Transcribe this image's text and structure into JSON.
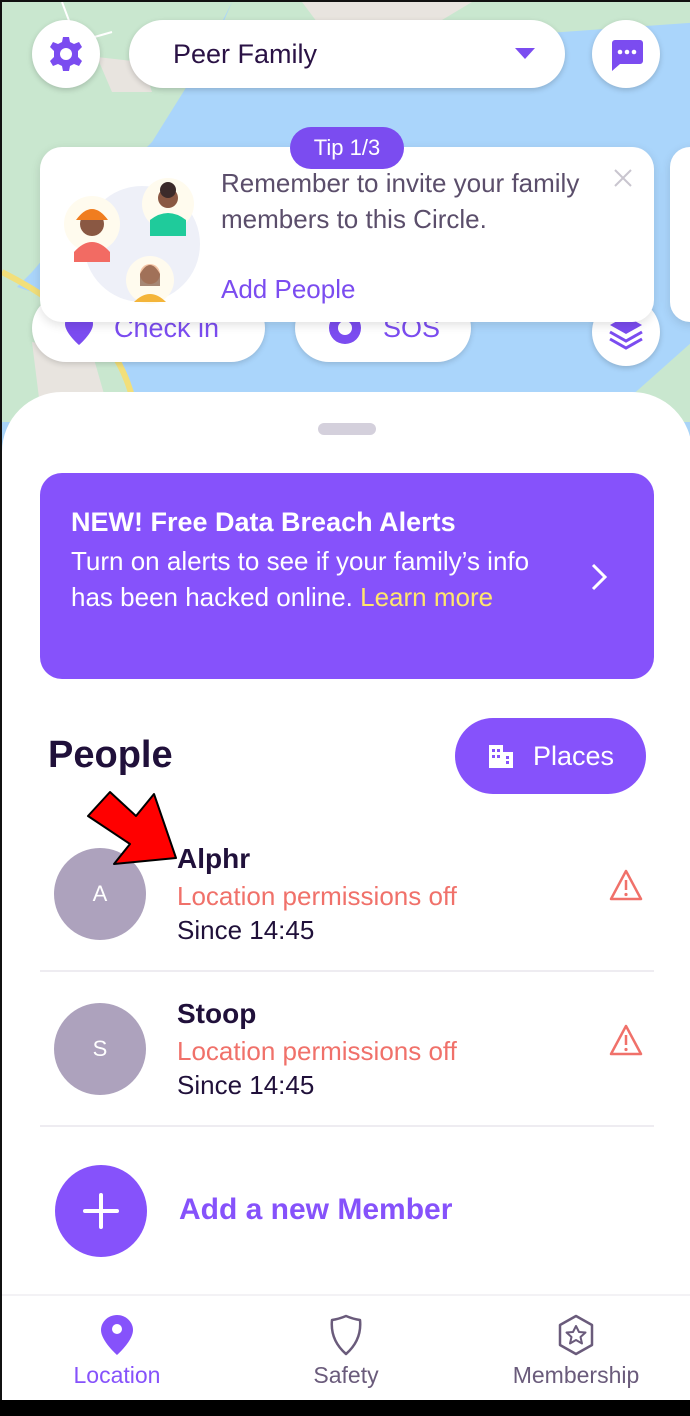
{
  "header": {
    "circle_name": "Peer Family",
    "settings_icon": "gear-icon",
    "messages_icon": "chat-bubble-icon",
    "dropdown_icon": "caret-down-icon"
  },
  "map_actions": {
    "check_in_label": "Check in",
    "check_in_icon": "location-pin-icon",
    "sos_label": "SOS",
    "sos_icon": "lifebuoy-icon",
    "layers_icon": "layers-icon"
  },
  "tip": {
    "badge": "Tip 1/3",
    "text": "Remember to invite your family members to this Circle.",
    "link": "Add People",
    "close_icon": "close-icon"
  },
  "promo": {
    "title": "NEW! Free Data Breach Alerts",
    "body": "Turn on alerts to see if your family’s info has been hacked online.",
    "link": "Learn more",
    "chevron_icon": "chevron-right-icon"
  },
  "people": {
    "title": "People",
    "places_label": "Places",
    "places_icon": "building-icon",
    "members": [
      {
        "initial": "A",
        "name": "Alphr",
        "status": "Location permissions off",
        "since": "Since 14:45"
      },
      {
        "initial": "S",
        "name": "Stoop",
        "status": "Location permissions off",
        "since": "Since 14:45"
      }
    ],
    "add_member_label": "Add a new Member"
  },
  "tabbar": {
    "tabs": [
      {
        "label": "Location",
        "icon": "location-pin-icon",
        "active": true
      },
      {
        "label": "Safety",
        "icon": "shield-icon",
        "active": false
      },
      {
        "label": "Membership",
        "icon": "star-badge-icon",
        "active": false
      }
    ]
  },
  "colors": {
    "accent": "#8652fb",
    "warning": "#f0716a",
    "link_yellow": "#ffe66b",
    "text_dark": "#20103a"
  }
}
